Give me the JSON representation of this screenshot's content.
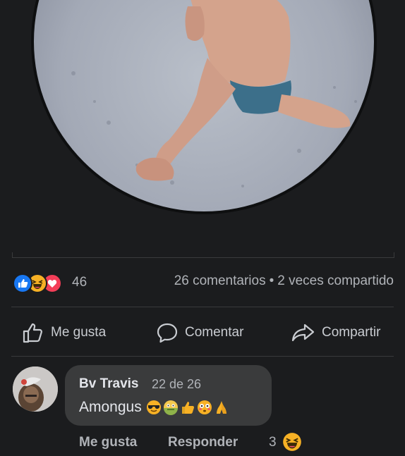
{
  "post": {
    "reaction_icons": [
      "like-icon",
      "haha-icon",
      "love-icon"
    ],
    "reaction_count": "46",
    "comments_text": "26 comentarios",
    "separator": "•",
    "shares_text": "2 veces compartido"
  },
  "actions": {
    "like_label": "Me gusta",
    "comment_label": "Comentar",
    "share_label": "Compartir"
  },
  "comment": {
    "author": "Bv Travis",
    "date": "22 de 26",
    "text": "Amongus",
    "emoji_icons": [
      "sunglasses-emoji",
      "nauseated-emoji",
      "thumbs-up-emoji",
      "flushed-emoji",
      "folded-hands-emoji"
    ],
    "like_label": "Me gusta",
    "reply_label": "Responder",
    "reaction_count": "3",
    "reaction_icon": "haha-icon"
  },
  "colors": {
    "background": "#1b1c1e",
    "bubble": "#3a3b3c",
    "like_blue": "#1877f2",
    "love_red": "#f33e58",
    "haha_yellow": "#f7b125",
    "secondary_text": "#b0b3b8"
  }
}
